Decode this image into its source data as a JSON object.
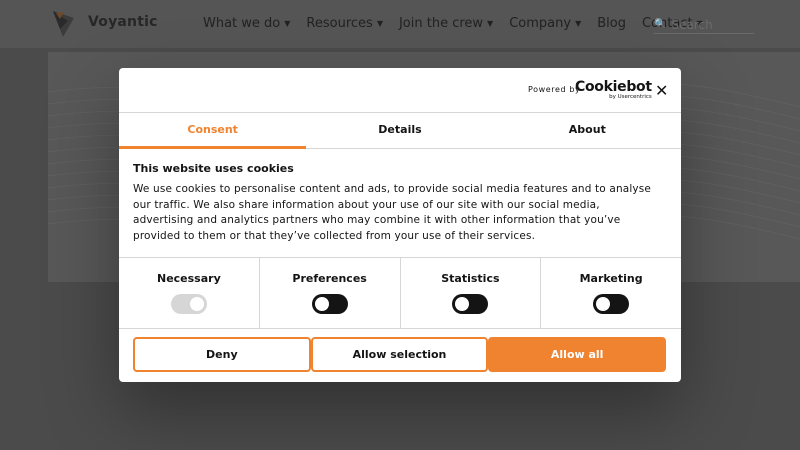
{
  "brand": {
    "name": "Voyantic",
    "logo": "voyantic-logo"
  },
  "nav": {
    "items": [
      {
        "label": "What we do",
        "dropdown": true
      },
      {
        "label": "Resources",
        "dropdown": true
      },
      {
        "label": "Join the crew",
        "dropdown": true
      },
      {
        "label": "Company",
        "dropdown": true
      },
      {
        "label": "Blog",
        "dropdown": false
      },
      {
        "label": "Contact",
        "dropdown": true
      }
    ],
    "search_placeholder": "Search"
  },
  "dialog": {
    "powered_by": "Powered by",
    "provider": "Cookiebot",
    "provider_sub": "by Usercentrics",
    "close_icon": "close-icon",
    "tabs": [
      {
        "label": "Consent",
        "active": true
      },
      {
        "label": "Details",
        "active": false
      },
      {
        "label": "About",
        "active": false
      }
    ],
    "heading": "This website uses cookies",
    "text": "We use cookies to personalise content and ads, to provide social media features and to analyse our traffic. We also share information about your use of our site with our social media, advertising and analytics partners who may combine it with other information that you’ve provided to them or that they’ve collected from your use of their services.",
    "categories": [
      {
        "label": "Necessary",
        "enabled": true,
        "locked": true
      },
      {
        "label": "Preferences",
        "enabled": false,
        "locked": false
      },
      {
        "label": "Statistics",
        "enabled": false,
        "locked": false
      },
      {
        "label": "Marketing",
        "enabled": false,
        "locked": false
      }
    ],
    "buttons": {
      "deny": "Deny",
      "allow_selection": "Allow selection",
      "allow_all": "Allow all"
    }
  },
  "colors": {
    "accent": "#f0832f",
    "overlay": "#4b4b4b",
    "text": "#141414"
  }
}
